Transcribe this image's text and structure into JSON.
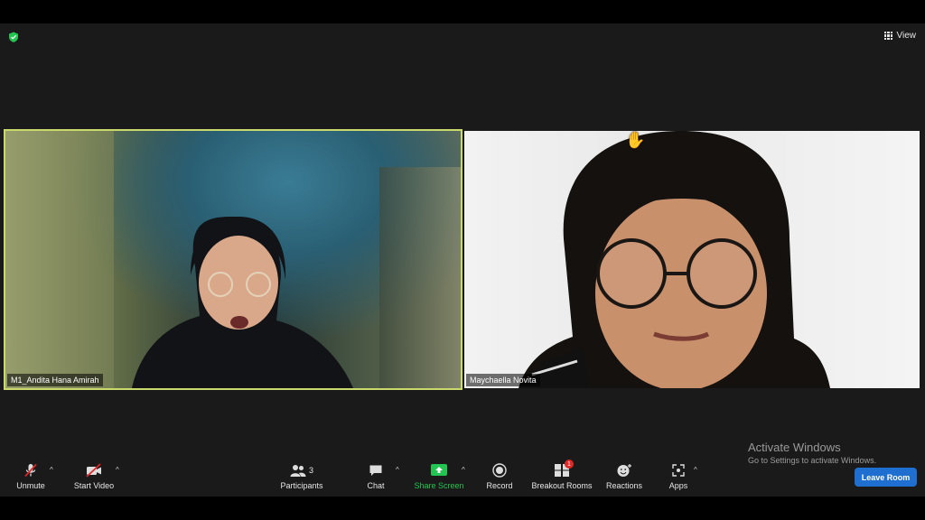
{
  "view": {
    "label": "View"
  },
  "participants": [
    {
      "name": "M1_Andita Hana Amirah"
    },
    {
      "name": "Maychaella Novita"
    }
  ],
  "watermark": {
    "title": "Activate Windows",
    "subtitle": "Go to Settings to activate Windows."
  },
  "toolbar": {
    "unmute": "Unmute",
    "start_video": "Start Video",
    "participants": "Participants",
    "participants_count": "3",
    "chat": "Chat",
    "share_screen": "Share Screen",
    "record": "Record",
    "breakout_rooms": "Breakout Rooms",
    "breakout_badge": "1",
    "reactions": "Reactions",
    "apps": "Apps",
    "leave": "Leave Room"
  },
  "colors": {
    "active_speaker_border": "#c9d96b",
    "share_green": "#23c552",
    "leave_blue": "#1f6fd1",
    "muted_red": "#e02828"
  }
}
